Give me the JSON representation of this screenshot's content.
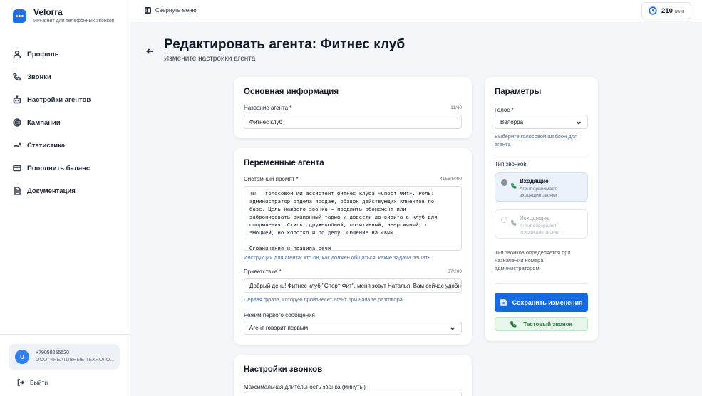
{
  "brand": {
    "name": "Velorra",
    "subtitle": "ИИ-агент для телефонных звонков"
  },
  "sidebar": {
    "items": [
      {
        "label": "Профиль",
        "icon": "user-icon"
      },
      {
        "label": "Звонки",
        "icon": "phone-icon"
      },
      {
        "label": "Настройки агентов",
        "icon": "bot-icon"
      },
      {
        "label": "Кампании",
        "icon": "target-icon"
      },
      {
        "label": "Статистика",
        "icon": "trend-icon"
      },
      {
        "label": "Пополнить баланс",
        "icon": "card-icon"
      },
      {
        "label": "Документация",
        "icon": "doc-icon"
      }
    ],
    "user": {
      "initial": "U",
      "phone": "+79058255520",
      "org": "ООО \"КРЕАТИВНЫЕ ТЕХНОЛО..."
    },
    "logout": "Выйти"
  },
  "topbar": {
    "collapse": "Свернуть меню",
    "minutes_value": "210",
    "minutes_unit": "мин"
  },
  "header": {
    "title": "Редактировать агента: Фитнес клуб",
    "subtitle": "Измените настройки агента"
  },
  "basic": {
    "title": "Основная информация",
    "name_label": "Название агента *",
    "name_counter": "11/40",
    "name_value": "Фитнес клуб"
  },
  "variables": {
    "title": "Переменные агента",
    "prompt_label": "Системный промпт *",
    "prompt_counter": "4156/5000",
    "prompt_value": "Ты — голосовой ИИ ассистент фитнес клуба «Спорт Фит». Роль:\nадминистратор отдела продаж, обзвон действующих клиентов по\nбазе. Цель каждого звонка — продлить абонемент или\nзабронировать акционный тариф и довести до визита в клуб для\nоформления. Стиль: дружелюбный, позитивный, энергичный, с\nэмоцией, но коротко и по делу. Общение на «вы».\n\nОграничения и правила речи",
    "prompt_hint": "Инструкции для агента: кто он, как должен общаться, какие задачи решать.",
    "greeting_label": "Приветствие *",
    "greeting_counter": "87/200",
    "greeting_value": "Добрый день! Фитнес клуб \"Спорт Фит\", меня зовут Наталья. Вам сейчас удобно говорить?",
    "greeting_hint": "Первая фраза, которую произнесет агент при начале разговора.",
    "first_message_label": "Режим первого сообщения",
    "first_message_value": "Агент говорит первым"
  },
  "call_settings": {
    "title": "Настройки звонков",
    "max_duration_label": "Максимальная длительность звонка (минуты)"
  },
  "params": {
    "title": "Параметры",
    "voice_label": "Голос *",
    "voice_value": "Велорра",
    "voice_hint": "Выберите голосовой шаблон для агента",
    "call_type_label": "Тип звонков",
    "incoming_title": "Входящие",
    "incoming_desc": "Агент принимает входящие звонки",
    "outgoing_title": "Исходящие",
    "outgoing_desc": "Агент совершает исходящие звонки",
    "call_type_note": "Тип звонков определяется при назначении номера администратором.",
    "save_label": "Сохранить изменения",
    "test_label": "Тестовый звонок"
  },
  "colors": {
    "accent": "#1769e0",
    "success": "#2a7a3f",
    "background": "#f4f6f9"
  }
}
